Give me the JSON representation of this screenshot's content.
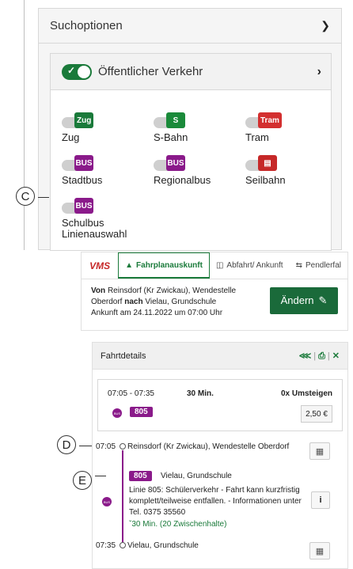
{
  "search_options": {
    "title": "Suchoptionen",
    "public_transport": {
      "label": "Öffentlicher Verkehr",
      "enabled": true
    },
    "modes": [
      {
        "label": "Zug",
        "badge": "Zug",
        "icon": "train-icon"
      },
      {
        "label": "S-Bahn",
        "badge": "S",
        "icon": "sbahn-icon"
      },
      {
        "label": "Tram",
        "badge": "Tram",
        "icon": "tram-icon"
      },
      {
        "label": "Stadtbus",
        "badge": "BUS",
        "icon": "bus-icon"
      },
      {
        "label": "Regionalbus",
        "badge": "BUS",
        "icon": "bus-icon"
      },
      {
        "label": "Seilbahn",
        "badge": "",
        "icon": "cable-car-icon"
      },
      {
        "label": "Schulbus",
        "badge": "BUS",
        "icon": "school-bus-icon"
      }
    ],
    "line_selection": "Linienauswahl"
  },
  "callouts": {
    "c": "C",
    "d": "D",
    "e": "E"
  },
  "nav": {
    "logo": "VMS",
    "tabs": [
      "Fahrplanauskunft",
      "Abfahrt/ Ankunft",
      "Pendlerfal"
    ]
  },
  "search_summary": {
    "from_label": "Von",
    "from": "Reinsdorf (Kr Zwickau), Wendestelle Oberdorf",
    "to_label": "nach",
    "to": "Vielau, Grundschule",
    "arrival": "Ankunft am 24.11.2022 um 07:00 Uhr",
    "change_button": "Ändern"
  },
  "trip": {
    "header": "Fahrtdetails",
    "time_range": "07:05 - 07:35",
    "duration": "30 Min.",
    "transfers": "0x Umsteigen",
    "line": "805",
    "price": "2,50 €",
    "departure_time": "07:05",
    "departure_stop": "Reinsdorf (Kr Zwickau), Wendestelle Oberdorf",
    "leg_direction": "Vielau, Grundschule",
    "notice": "Linie 805: Schülerverkehr - Fahrt kann kurzfristig komplett/teilweise entfallen. - Informationen unter Tel. 0375 35560",
    "intermediate": "30 Min. (20 Zwischenhalte)",
    "arrival_time": "07:35",
    "arrival_stop": "Vielau, Grundschule"
  },
  "colors": {
    "green": "#1a7a3a",
    "bus": "#8a1a8a",
    "tram": "#d32f2f"
  }
}
